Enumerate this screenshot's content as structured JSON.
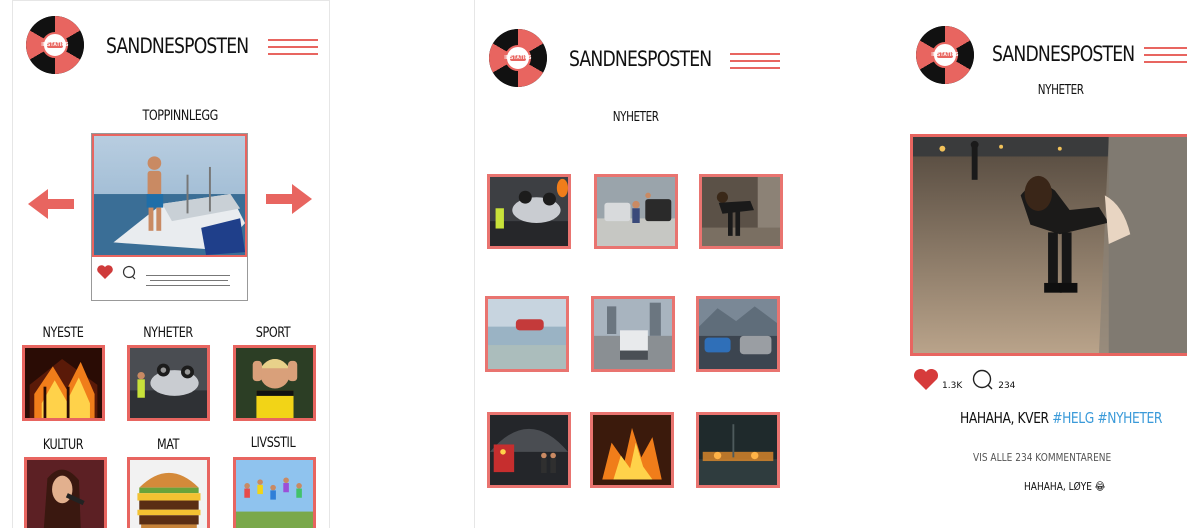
{
  "brand": {
    "name": "SANDNESPOSTEN",
    "logo_text": "INSTATIPS",
    "accent": "#e86560",
    "hashtag_color": "#3a9ad9"
  },
  "screen_home": {
    "section_title": "TOPPINNLEGG",
    "featured_post": {
      "image": "man-on-sinking-boat-photo",
      "actions": [
        "heart-icon",
        "comment-icon"
      ]
    },
    "categories": [
      {
        "label": "NYESTE",
        "image": "burning-house-photo"
      },
      {
        "label": "NYHETER",
        "image": "overturned-car-photo"
      },
      {
        "label": "SPORT",
        "image": "football-player-photo"
      },
      {
        "label": "KULTUR",
        "image": "singer-photo"
      },
      {
        "label": "MAT",
        "image": "burger-photo"
      },
      {
        "label": "LIVSSTIL",
        "image": "jumping-people-photo"
      }
    ]
  },
  "screen_news": {
    "section_title": "NYHETER",
    "tiles": [
      "overturned-car-photo",
      "car-accident-photo",
      "woman-at-window-photo",
      "car-in-water-photo",
      "parking-lot-photo",
      "crashed-car-photo",
      "firefighters-tunnel-photo",
      "car-fire-photo",
      "night-fire-photo"
    ]
  },
  "screen_post": {
    "section_title": "NYHETER",
    "image": "woman-at-window-photo",
    "likes": "1.3K",
    "comments_count": "234",
    "caption_text": "HAHAHA, KVER",
    "hashtags": [
      "#HELG",
      "#NYHETER"
    ],
    "view_all_comments": "VIS ALLE 234 KOMMENTARENE",
    "comment_text": "HAHAHA, LØYE",
    "comment_emoji": "😂"
  }
}
